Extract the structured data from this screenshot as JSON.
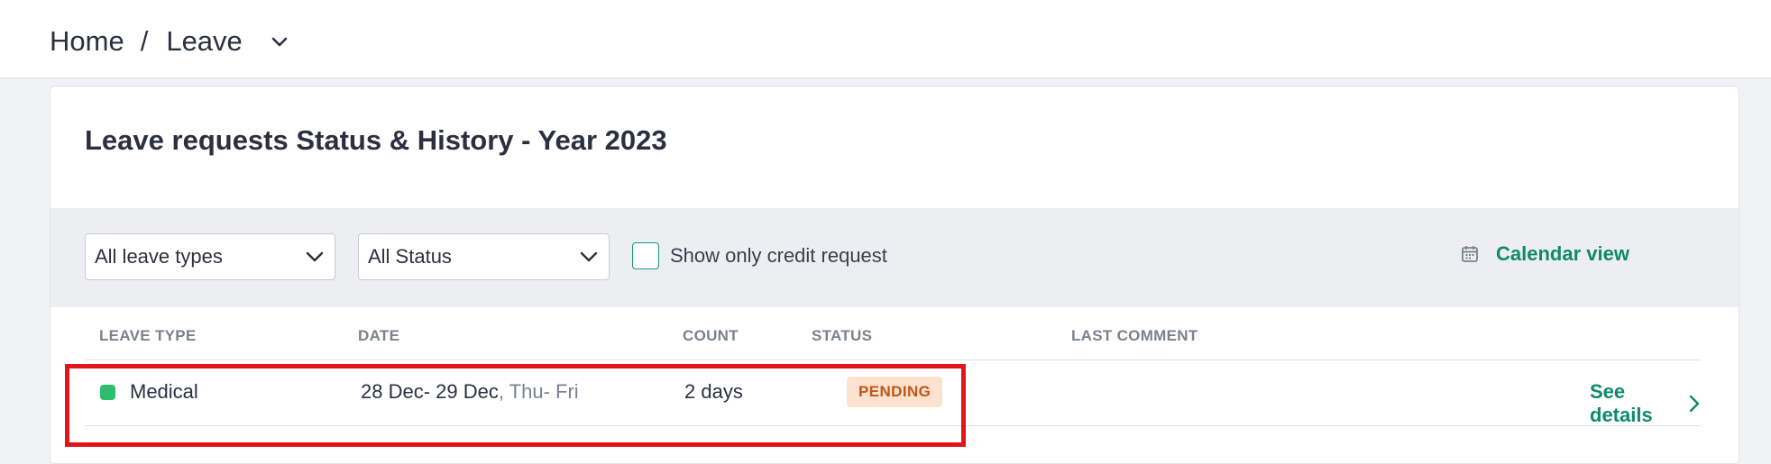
{
  "breadcrumb": {
    "home": "Home",
    "separator": "/",
    "current": "Leave"
  },
  "card": {
    "title": "Leave requests Status & History - Year 2023"
  },
  "filters": {
    "leave_types": "All leave types",
    "status": "All Status",
    "credit_label": "Show only credit request",
    "calendar_label": "Calendar view"
  },
  "table": {
    "headers": [
      "LEAVE TYPE",
      "DATE",
      "COUNT",
      "STATUS",
      "LAST COMMENT"
    ],
    "rows": [
      {
        "leave_type": "Medical",
        "date": "28 Dec- 29 Dec",
        "days": ", Thu- Fri",
        "count": "2 days",
        "status": "PENDING",
        "last_comment": "",
        "action": "See details"
      }
    ]
  },
  "colors": {
    "accent": "#149a7a",
    "link": "#0f8a6a",
    "medical_dot": "#2ebd6b",
    "pending_bg": "#fde2cf",
    "pending_text": "#c2561a",
    "highlight": "#e0161b"
  },
  "icons": {
    "dropdown": "chevron-down-icon",
    "calendar": "calendar-icon",
    "row_action": "chevron-right-icon"
  }
}
